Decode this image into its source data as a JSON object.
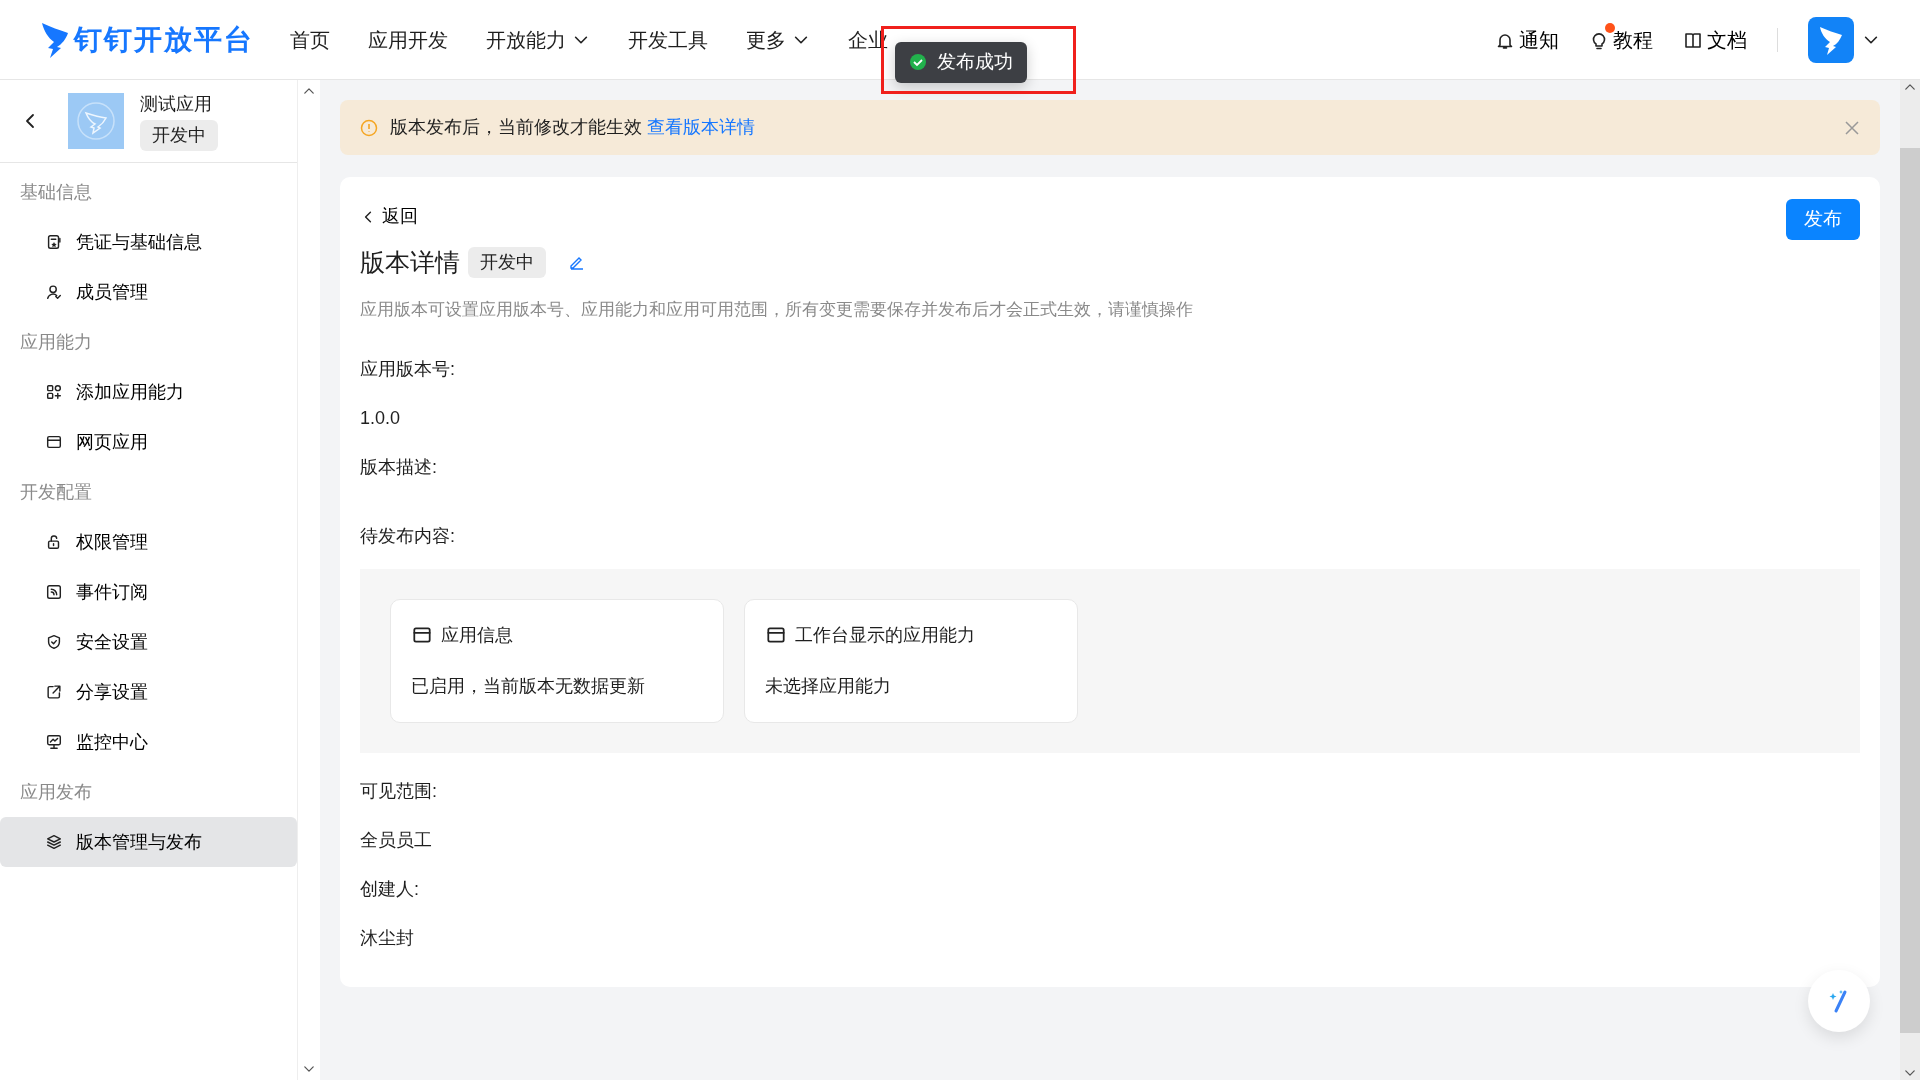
{
  "nav": {
    "logo": "钉钉开放平台",
    "items": [
      {
        "label": "首页",
        "dropdown": false
      },
      {
        "label": "应用开发",
        "dropdown": false
      },
      {
        "label": "开放能力",
        "dropdown": true
      },
      {
        "label": "开发工具",
        "dropdown": false
      },
      {
        "label": "更多",
        "dropdown": true
      },
      {
        "label": "企业",
        "dropdown": false
      }
    ],
    "tools": [
      {
        "label": "通知",
        "dot": false
      },
      {
        "label": "教程",
        "dot": true
      },
      {
        "label": "文档",
        "dot": false
      }
    ]
  },
  "toast": {
    "text": "发布成功"
  },
  "sidebar": {
    "app_name": "测试应用",
    "status": "开发中",
    "groups": [
      {
        "title": "基础信息",
        "items": [
          {
            "label": "凭证与基础信息",
            "selected": false
          },
          {
            "label": "成员管理",
            "selected": false
          }
        ]
      },
      {
        "title": "应用能力",
        "items": [
          {
            "label": "添加应用能力",
            "selected": false
          },
          {
            "label": "网页应用",
            "selected": false
          }
        ]
      },
      {
        "title": "开发配置",
        "items": [
          {
            "label": "权限管理",
            "selected": false
          },
          {
            "label": "事件订阅",
            "selected": false
          },
          {
            "label": "安全设置",
            "selected": false
          },
          {
            "label": "分享设置",
            "selected": false
          },
          {
            "label": "监控中心",
            "selected": false
          }
        ]
      },
      {
        "title": "应用发布",
        "items": [
          {
            "label": "版本管理与发布",
            "selected": true
          }
        ]
      }
    ]
  },
  "alert": {
    "text": "版本发布后，当前修改才能生效",
    "link": "查看版本详情"
  },
  "detail": {
    "back": "返回",
    "title": "版本详情",
    "status": "开发中",
    "publish": "发布",
    "description": "应用版本可设置应用版本号、应用能力和应用可用范围，所有变更需要保存并发布后才会正式生效，请谨慎操作",
    "fields": [
      {
        "kind": "text",
        "label": "应用版本号:",
        "value": "1.0.0"
      },
      {
        "kind": "text",
        "label": "版本描述:"
      },
      {
        "kind": "cards",
        "label": "待发布内容:",
        "cards": [
          {
            "title": "应用信息",
            "text": "已启用，当前版本无数据更新"
          },
          {
            "title": "工作台显示的应用能力",
            "text": "未选择应用能力"
          }
        ]
      },
      {
        "kind": "text",
        "label": "可见范围:",
        "value": "全员员工"
      },
      {
        "kind": "text",
        "label": "创建人:",
        "value": "沐尘封"
      }
    ]
  }
}
